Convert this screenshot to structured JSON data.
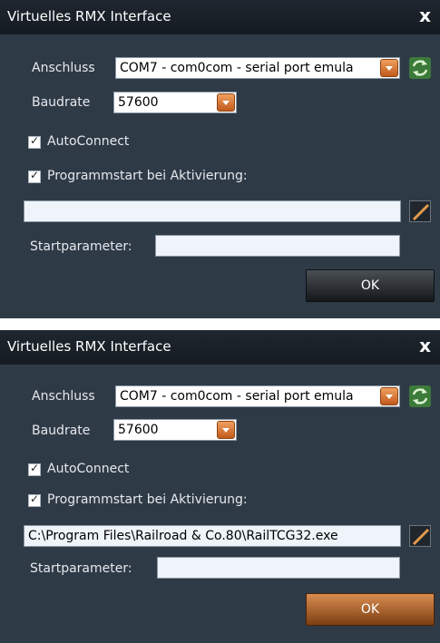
{
  "dialogs": [
    {
      "title": "Virtuelles RMX Interface",
      "close_label": "x",
      "port_label": "Anschluss",
      "port_value": "COM7 - com0com - serial port emula",
      "baud_label": "Baudrate",
      "baud_value": "57600",
      "autoconnect_label": "AutoConnect",
      "autoconnect_checked": true,
      "programstart_label": "Programmstart bei Aktivierung:",
      "programstart_checked": true,
      "program_path": "",
      "startparam_label": "Startparameter:",
      "startparam_value": "",
      "ok_label": "OK"
    },
    {
      "title": "Virtuelles RMX Interface",
      "close_label": "x",
      "port_label": "Anschluss",
      "port_value": "COM7 - com0com - serial port emula",
      "baud_label": "Baudrate",
      "baud_value": "57600",
      "autoconnect_label": "AutoConnect",
      "autoconnect_checked": true,
      "programstart_label": "Programmstart bei Aktivierung:",
      "programstart_checked": true,
      "program_path": "C:\\Program Files\\Railroad & Co.80\\RailTCG32.exe",
      "startparam_label": "Startparameter:",
      "startparam_value": "",
      "ok_label": "OK"
    }
  ],
  "colors": {
    "dialog_bg": "#2f3a47",
    "titlebar_bg": "#1a2128",
    "ok_dark": "#2a2e33",
    "ok_orange": "#b8652a",
    "combo_arrow": "#d9782f",
    "refresh_green": "#3c7a3a"
  },
  "icons": {
    "refresh": "refresh-icon",
    "browse": "edit-pencil-icon",
    "dropdown": "chevron-down-icon",
    "close": "close-icon"
  }
}
